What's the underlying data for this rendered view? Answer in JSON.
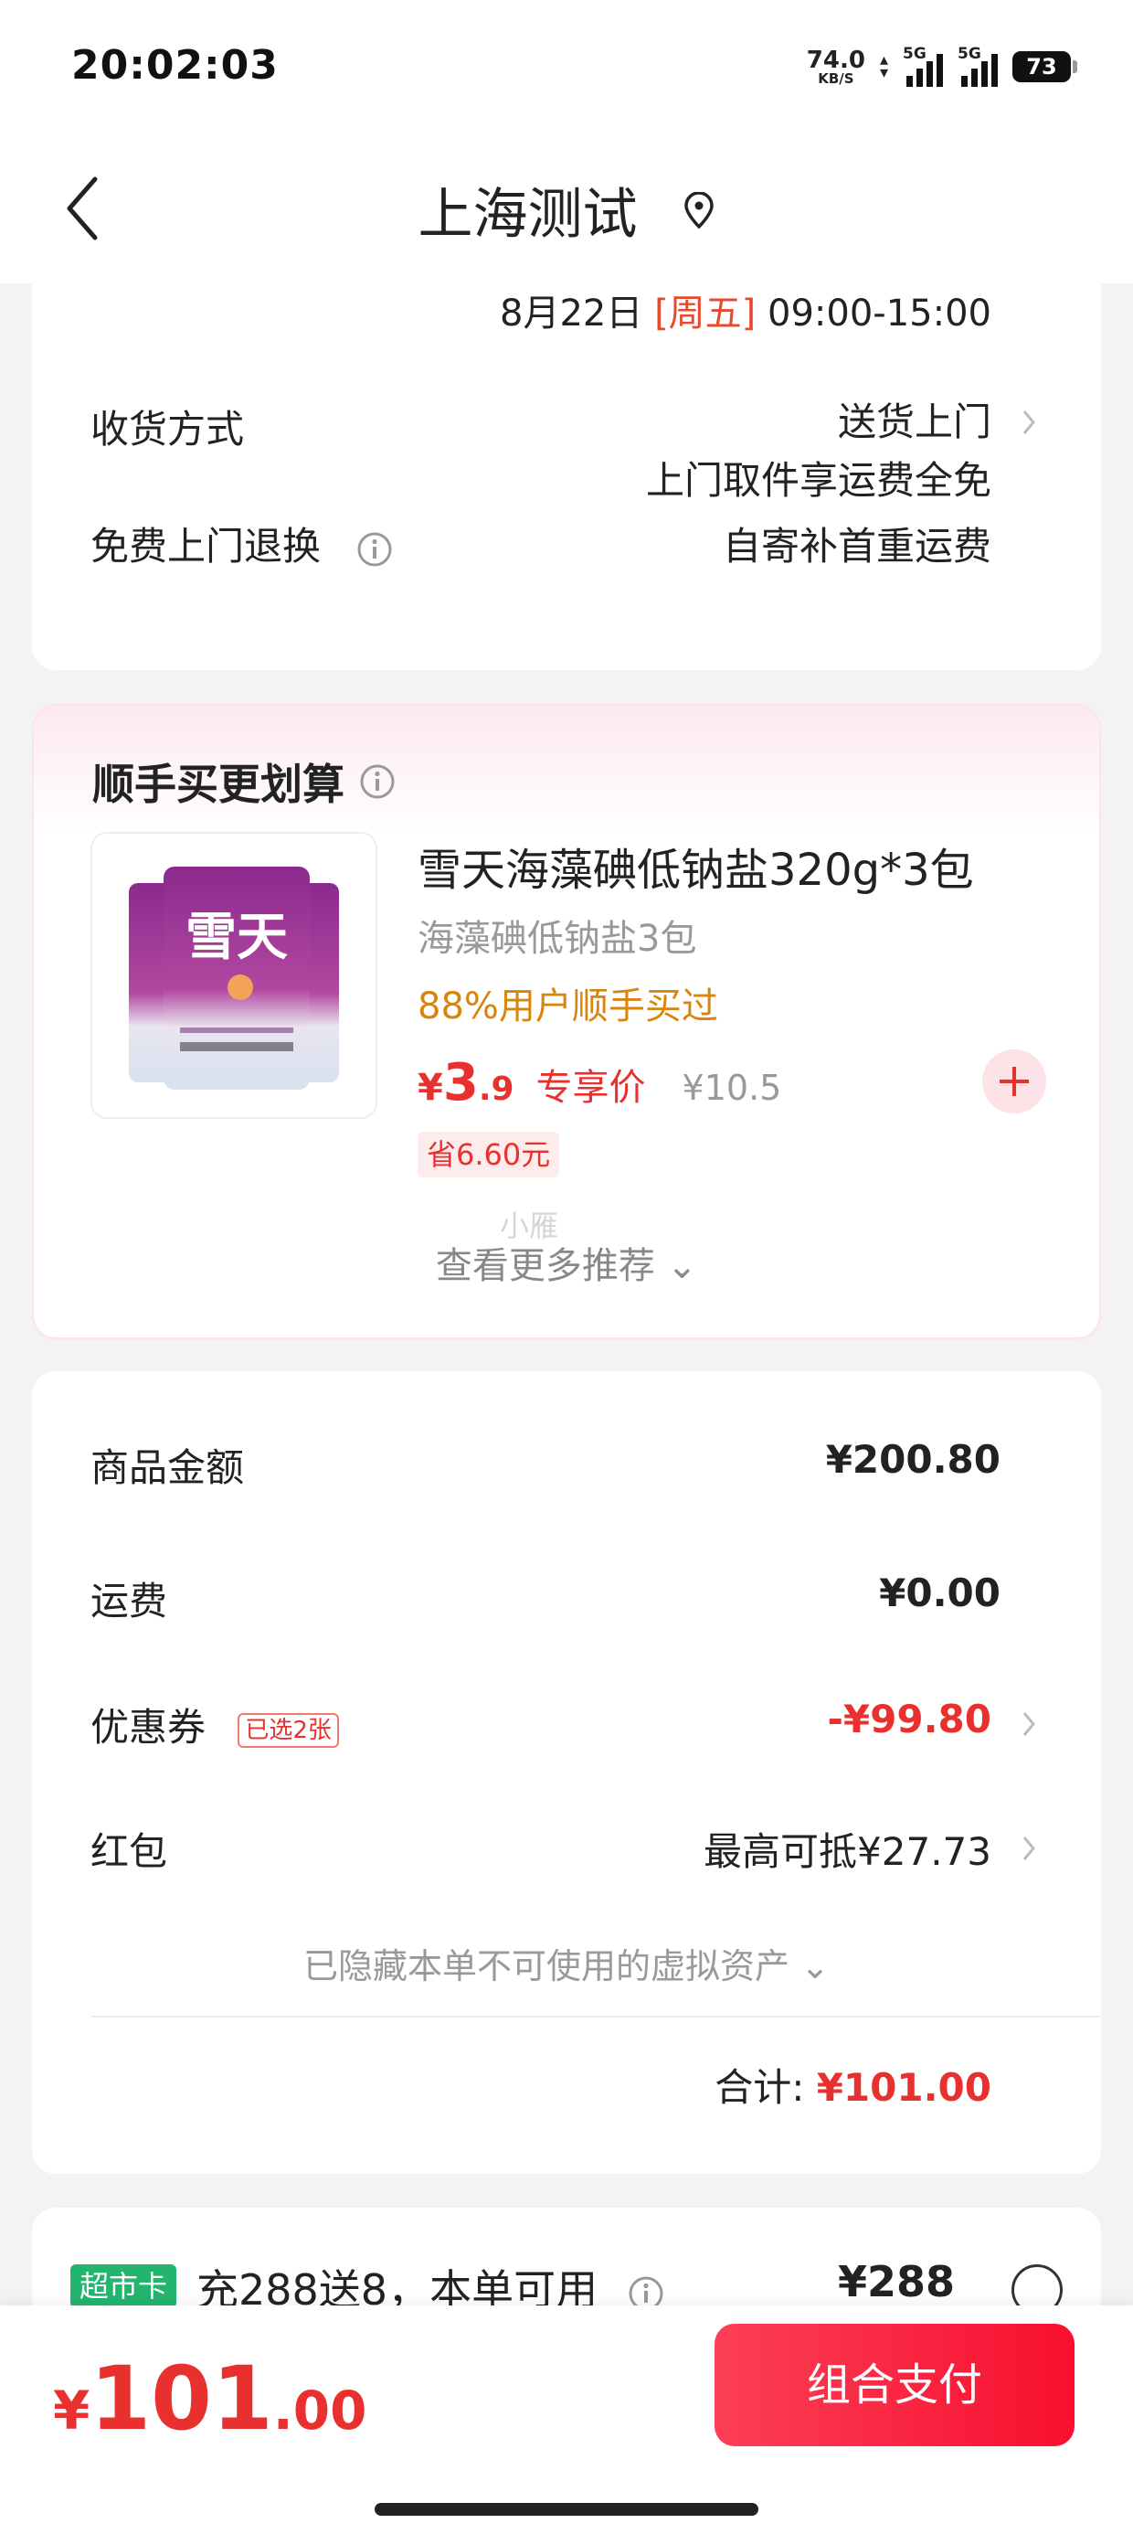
{
  "status_bar": {
    "time": "20:02:03",
    "net_speed": "74.0",
    "net_unit": "KB/S",
    "signal1_label": "5G",
    "signal2_label": "5G",
    "battery": "73"
  },
  "header": {
    "title": "上海测试",
    "back_icon": "chevron-left-icon",
    "location_icon": "location-pin-icon"
  },
  "delivery": {
    "date": "8月22日",
    "weekday": "[周五]",
    "time_range": "09:00-15:00",
    "method_label": "收货方式",
    "method_value": "送货上门",
    "return_label": "免费上门退换",
    "return_line1": "上门取件享运费全免",
    "return_line2": "自寄补首重运费"
  },
  "recommend": {
    "title": "顺手买更划算",
    "product": {
      "name": "雪天海藻碘低钠盐320g*3包",
      "subtitle": "海藻碘低钠盐3包",
      "tag": "88%用户顺手买过",
      "price_symbol": "¥",
      "price_int": "3",
      "price_dec": ".9",
      "price_label": "专享价",
      "original_price": "¥10.5",
      "save": "省6.60元",
      "image_text": "雪天"
    },
    "watermark": "小雁",
    "more": "查看更多推荐 ⌄"
  },
  "summary": {
    "items": [
      {
        "label": "商品金额",
        "value": "¥200.80"
      },
      {
        "label": "运费",
        "value": "¥0.00"
      },
      {
        "label": "优惠券",
        "badge": "已选2张",
        "value": "-¥99.80"
      },
      {
        "label": "红包",
        "value": "最高可抵¥27.73"
      }
    ],
    "hidden_assets": "已隐藏本单不可使用的虚拟资产 ⌄",
    "total_label": "合计:",
    "total_value": "¥101.00"
  },
  "supermarket_card": {
    "badge": "超市卡",
    "offer": "充288送8，本单可用",
    "price": "¥288"
  },
  "bottom": {
    "symbol": "¥",
    "int": "101",
    "dec": ".00",
    "pay_label": "组合支付"
  },
  "colors": {
    "accent_red": "#e8312e",
    "tag_orange": "#d9850c",
    "card_green": "#22b56e",
    "pay_button": "#fb3f57"
  }
}
